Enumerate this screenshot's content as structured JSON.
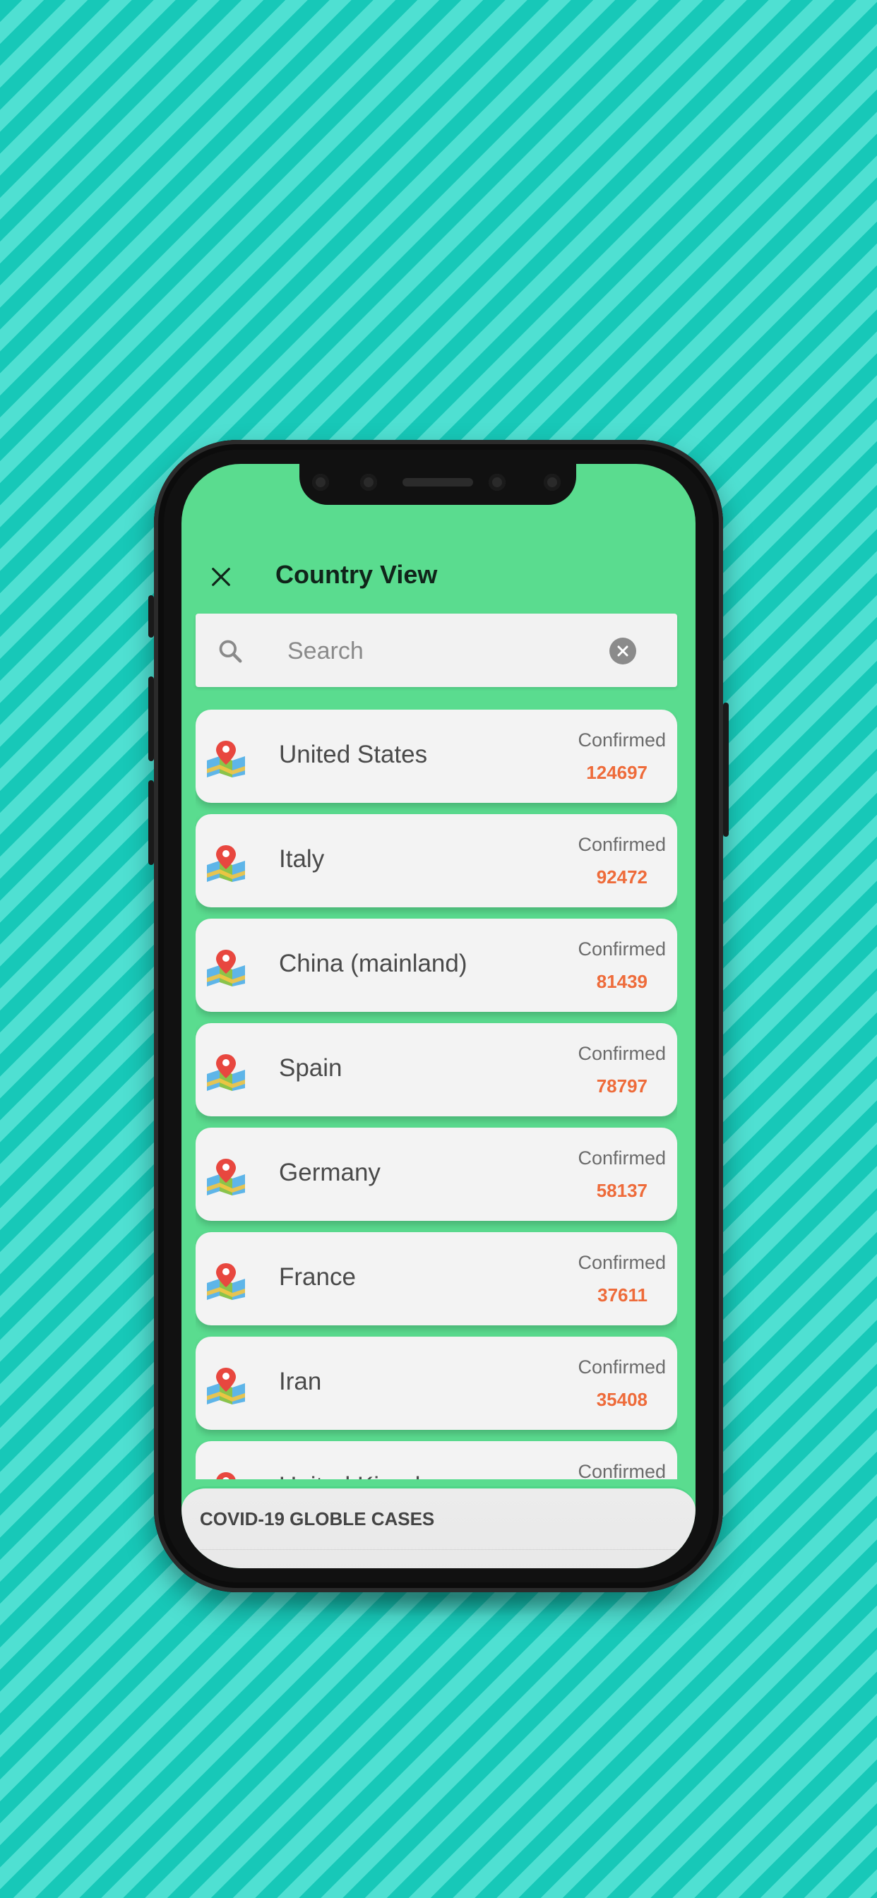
{
  "header": {
    "title": "Country View"
  },
  "search": {
    "placeholder": "Search"
  },
  "countries": [
    {
      "name": "United States",
      "label": "Confirmed",
      "value": "124697"
    },
    {
      "name": "Italy",
      "label": "Confirmed",
      "value": "92472"
    },
    {
      "name": "China (mainland)",
      "label": "Confirmed",
      "value": "81439"
    },
    {
      "name": "Spain",
      "label": "Confirmed",
      "value": "78797"
    },
    {
      "name": "Germany",
      "label": "Confirmed",
      "value": "58137"
    },
    {
      "name": "France",
      "label": "Confirmed",
      "value": "37611"
    },
    {
      "name": "Iran",
      "label": "Confirmed",
      "value": "35408"
    },
    {
      "name": "United Kingdom",
      "label": "Confirmed",
      "value": ""
    }
  ],
  "bottom_sheet": {
    "title": "COVID-19 GLOBLE CASES"
  },
  "icons": {
    "close": "close-icon",
    "search": "search-icon",
    "clear": "clear-icon",
    "country": "map-pin-icon"
  },
  "colors": {
    "app_bg": "#5adc8f",
    "card_bg": "#f3f3f3",
    "confirmed_value": "#ee6b3a",
    "backdrop": "#1fd0bf"
  }
}
